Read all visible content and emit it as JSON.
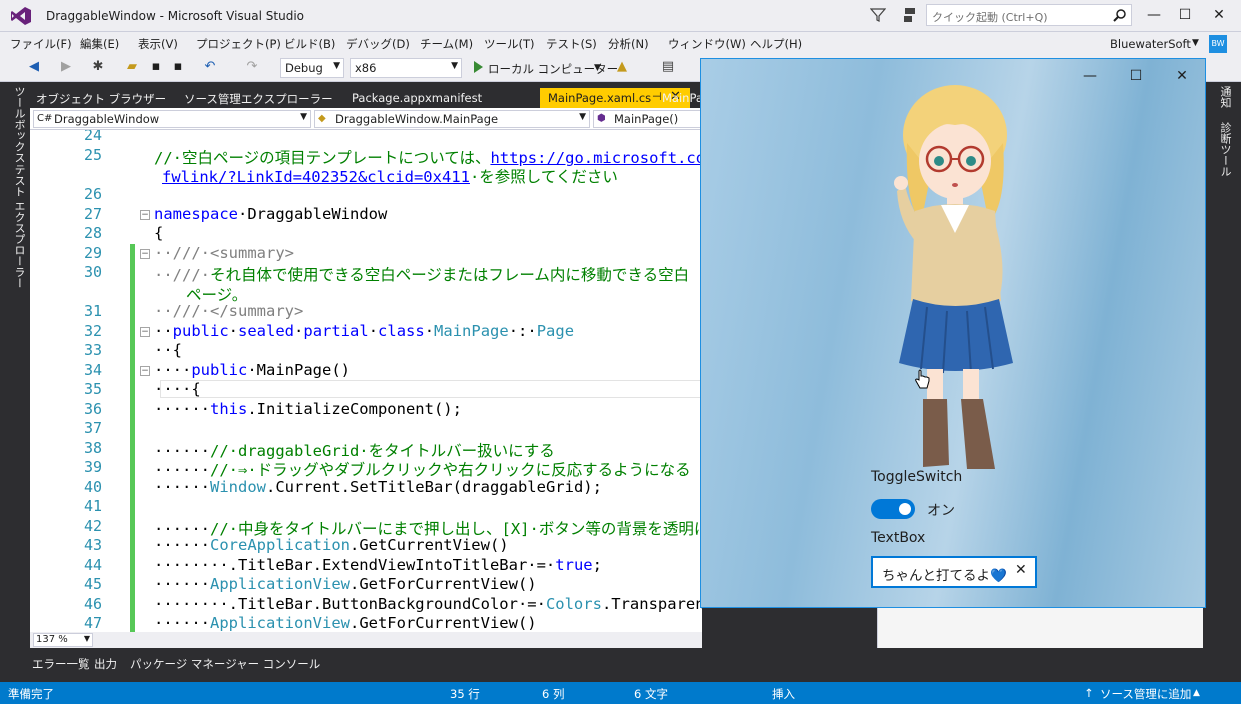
{
  "window": {
    "title": "DraggableWindow - Microsoft Visual Studio",
    "quick_launch_placeholder": "クイック起動 (Ctrl+Q)",
    "minimize": "—",
    "maximize": "☐",
    "close": "✕"
  },
  "menu": {
    "items": [
      "ファイル(F)",
      "編集(E)",
      "表示(V)",
      "プロジェクト(P)",
      "ビルド(B)",
      "デバッグ(D)",
      "チーム(M)",
      "ツール(T)",
      "テスト(S)",
      "分析(N)",
      "ウィンドウ(W)",
      "ヘルプ(H)"
    ],
    "account": "BluewaterSoft",
    "avatar": "BW"
  },
  "toolbar": {
    "config": "Debug",
    "platform": "x86",
    "run_target": "ローカル コンピューター"
  },
  "left_strip": [
    "ツールボックス",
    "テスト エクスプローラー"
  ],
  "right_strip": [
    "通知",
    "診断ツール"
  ],
  "doc_tabs": {
    "items": [
      "オブジェクト ブラウザー",
      "ソース管理エクスプローラー",
      "Package.appxmanifest"
    ],
    "active": "MainPage.xaml.cs",
    "next": "MainPa"
  },
  "nav_bar": {
    "project": "DraggableWindow",
    "type": "DraggableWindow.MainPage",
    "member": "MainPage()"
  },
  "editor": {
    "line_numbers": [
      "24",
      "25",
      "",
      "26",
      "27",
      "28",
      "29",
      "30",
      "",
      "31",
      "32",
      "33",
      "34",
      "35",
      "36",
      "37",
      "38",
      "39",
      "40",
      "41",
      "42",
      "43",
      "44",
      "45",
      "46",
      "47"
    ],
    "zoom": "137 %"
  },
  "bottom_tabs": [
    "エラー一覧",
    "出力",
    "パッケージ マネージャー コンソール"
  ],
  "status": {
    "ready": "準備完了",
    "line": "35 行",
    "col": "6 列",
    "ch": "6 文字",
    "mode": "挿入",
    "source_control": "ソース管理に追加"
  },
  "app": {
    "minimize": "—",
    "maximize": "☐",
    "close": "✕",
    "toggle_header": "ToggleSwitch",
    "toggle_state": "オン",
    "textbox_header": "TextBox",
    "textbox_value": "ちゃんと打てるよ💙",
    "textbox_clear": "✕"
  },
  "colors": {
    "accent": "#007ACC",
    "active_tab": "#FFCC00",
    "toggle_on": "#0078D7"
  }
}
